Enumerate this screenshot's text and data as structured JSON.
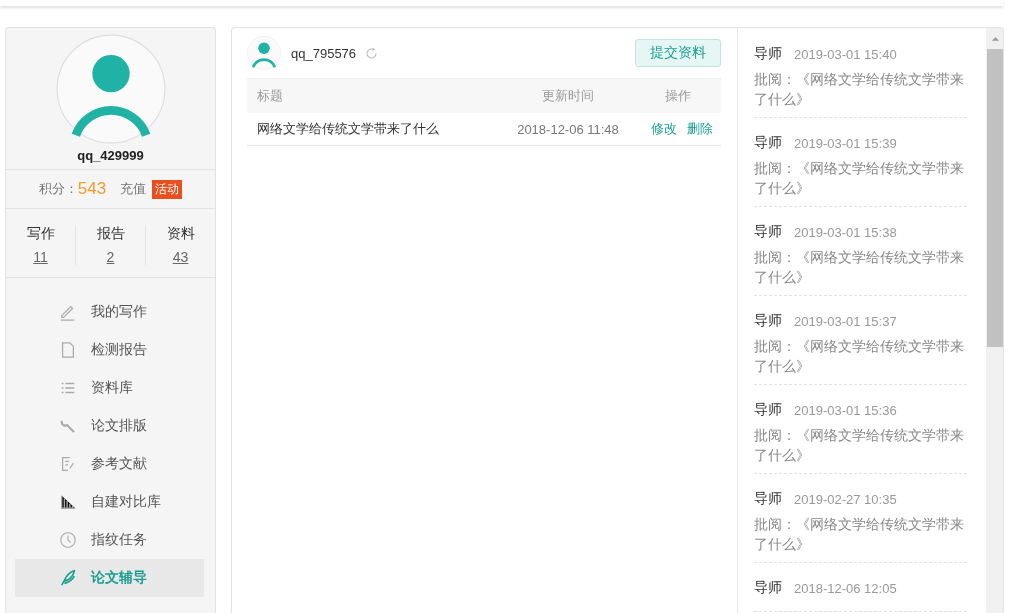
{
  "profile": {
    "username": "qq_429999",
    "points_label": "积分：",
    "points": "543",
    "recharge": "充值",
    "badge": "活动"
  },
  "stats": [
    {
      "label": "写作",
      "count": "11"
    },
    {
      "label": "报告",
      "count": "2"
    },
    {
      "label": "资料",
      "count": "43"
    }
  ],
  "menu": [
    {
      "label": "我的写作",
      "selected": false
    },
    {
      "label": "检测报告",
      "selected": false
    },
    {
      "label": "资料库",
      "selected": false
    },
    {
      "label": "论文排版",
      "selected": false
    },
    {
      "label": "参考文献",
      "selected": false
    },
    {
      "label": "自建对比库",
      "selected": false
    },
    {
      "label": "指纹任务",
      "selected": false
    },
    {
      "label": "论文辅导",
      "selected": true
    }
  ],
  "student": {
    "username": "qq_795576",
    "submit_button": "提交资料"
  },
  "table": {
    "columns": [
      "标题",
      "更新时间",
      "操作"
    ],
    "rows": [
      {
        "title": "网络文学给传统文学带来了什么",
        "updated": "2018-12-06 11:48",
        "actions": [
          "修改",
          "删除"
        ]
      }
    ]
  },
  "feed": [
    {
      "author": "导师",
      "time": "2019-03-01 15:40",
      "comment": "批阅：《网络文学给传统文学带来了什么》"
    },
    {
      "author": "导师",
      "time": "2019-03-01 15:39",
      "comment": "批阅：《网络文学给传统文学带来了什么》"
    },
    {
      "author": "导师",
      "time": "2019-03-01 15:38",
      "comment": "批阅：《网络文学给传统文学带来了什么》"
    },
    {
      "author": "导师",
      "time": "2019-03-01 15:37",
      "comment": "批阅：《网络文学给传统文学带来了什么》"
    },
    {
      "author": "导师",
      "time": "2019-03-01 15:36",
      "comment": "批阅：《网络文学给传统文学带来了什么》"
    },
    {
      "author": "导师",
      "time": "2019-02-27 10:35",
      "comment": "批阅：《网络文学给传统文学带来了什么》"
    },
    {
      "author": "导师",
      "time": "2018-12-06 12:05"
    }
  ]
}
